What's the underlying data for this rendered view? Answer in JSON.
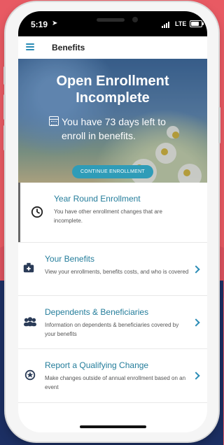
{
  "status_bar": {
    "time": "5:19",
    "location_icon": "location-arrow-icon",
    "network": "LTE",
    "battery_level": 0.75
  },
  "app_bar": {
    "menu_icon": "hamburger-menu-icon",
    "title": "Benefits"
  },
  "hero": {
    "title": "Open Enrollment Incomplete",
    "message": "You have 73 days left to enroll in benefits.",
    "icon": "calendar-icon",
    "button_label": "CONTINUE ENROLLMENT"
  },
  "items": [
    {
      "icon": "clock-icon",
      "title": "Year Round Enrollment",
      "description": "You have other enrollment changes that are incomplete.",
      "has_chevron": false,
      "highlighted": true
    },
    {
      "icon": "medical-kit-icon",
      "title": "Your Benefits",
      "description": "View your enrollments, benefits costs, and who is covered",
      "has_chevron": true,
      "highlighted": false
    },
    {
      "icon": "people-group-icon",
      "title": "Dependents & Beneficiaries",
      "description": "Information on dependents & beneficiaries covered by your benefits",
      "has_chevron": true,
      "highlighted": false
    },
    {
      "icon": "star-badge-icon",
      "title": "Report a Qualifying Change",
      "description": "Make changes outside of annual enrollment based on an event",
      "has_chevron": true,
      "highlighted": false
    }
  ],
  "colors": {
    "accent": "#2b8cb6",
    "title_text": "#247d9b",
    "button": "#2f9cb8",
    "background_top": "#e85a63",
    "background_bottom": "#1c2f63"
  }
}
